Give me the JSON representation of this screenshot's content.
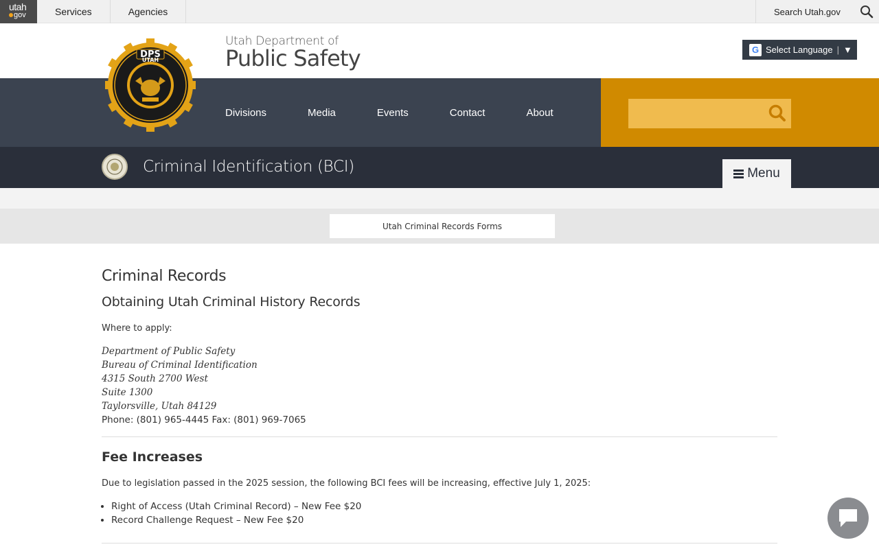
{
  "topbar": {
    "logo_top": "utah",
    "logo_bottom": "gov",
    "items": [
      {
        "label": "Services"
      },
      {
        "label": "Agencies"
      }
    ],
    "search_label": "Search Utah.gov"
  },
  "header": {
    "subtitle": "Utah Department of",
    "title": "Public Safety",
    "seal_top": "DPS",
    "seal_ring": "UTAH",
    "language_label": "Select Language",
    "nav": [
      {
        "label": "Divisions"
      },
      {
        "label": "Media"
      },
      {
        "label": "Events"
      },
      {
        "label": "Contact"
      },
      {
        "label": "About"
      }
    ]
  },
  "division": {
    "title": "Criminal Identification (BCI)",
    "menu_label": "Menu"
  },
  "subnav": {
    "button_label": "Utah Criminal Records Forms"
  },
  "content": {
    "heading": "Criminal Records",
    "subheading": "Obtaining Utah Criminal History Records",
    "where_label": "Where to apply:",
    "address": [
      "Department of Public Safety",
      "Bureau of Criminal Identification",
      "4315 South 2700 West",
      "Suite 1300",
      "Taylorsville, Utah 84129"
    ],
    "phone_line": "Phone: (801) 965-4445 Fax: (801) 969-7065",
    "fee_heading": "Fee Increases",
    "fee_intro": "Due to legislation passed in the 2025 session, the following BCI fees will be increasing, effective July 1, 2025:",
    "fee_items": [
      "Right of Access (Utah Criminal Record) – New Fee $20",
      "Record Challenge Request – New Fee $20"
    ]
  },
  "colors": {
    "nav_band": "#3b4350",
    "gold": "#d08a00",
    "division_bar": "#2a2f3a"
  }
}
